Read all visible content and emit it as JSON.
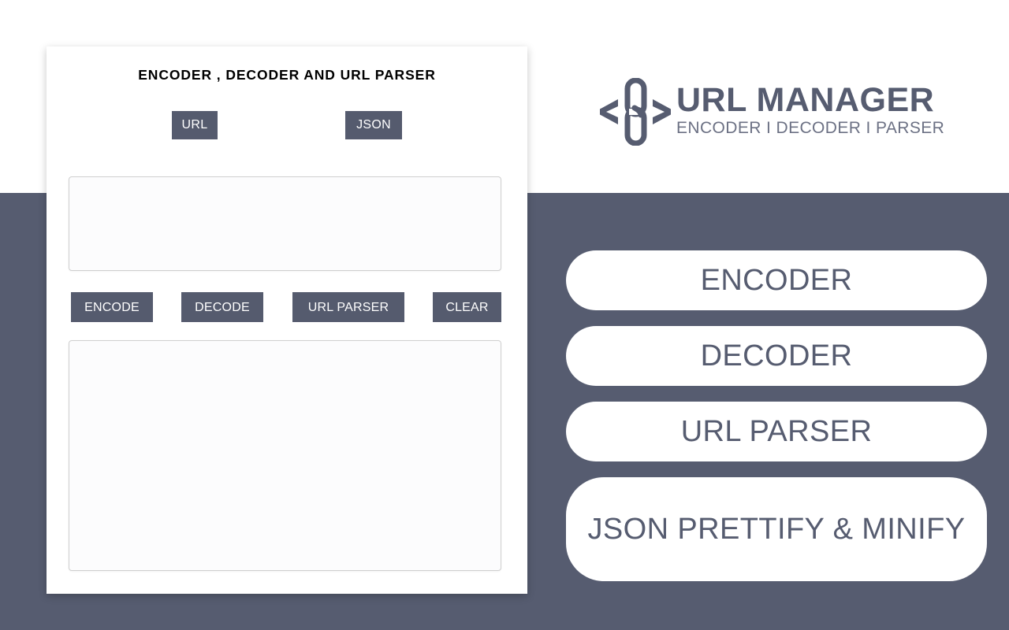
{
  "page": {
    "background_color": "#565c70",
    "header_band_color": "#ffffff",
    "accent_color": "#555b6e"
  },
  "tool_card": {
    "title": "ENCODER , DECODER AND URL PARSER",
    "mode_tabs": [
      {
        "label": "URL",
        "name": "url"
      },
      {
        "label": "JSON",
        "name": "json"
      }
    ],
    "input": {
      "value": "",
      "placeholder": ""
    },
    "output": {
      "value": "",
      "placeholder": ""
    },
    "actions": [
      {
        "label": "ENCODE",
        "name": "encode"
      },
      {
        "label": "DECODE",
        "name": "decode"
      },
      {
        "label": "URL PARSER",
        "name": "url-parser"
      },
      {
        "label": "CLEAR",
        "name": "clear"
      }
    ]
  },
  "brand": {
    "icon": "chain-link-icon",
    "left_bracket": "<",
    "right_bracket": ">",
    "title": "URL MANAGER",
    "subtitle": "ENCODER I DECODER I PARSER"
  },
  "nav": {
    "items": [
      {
        "label": "ENCODER",
        "name": "encoder"
      },
      {
        "label": "DECODER",
        "name": "decoder"
      },
      {
        "label": "URL PARSER",
        "name": "url-parser"
      },
      {
        "label": "JSON PRETTIFY & MINIFY",
        "name": "json-prettify-minify"
      }
    ]
  }
}
